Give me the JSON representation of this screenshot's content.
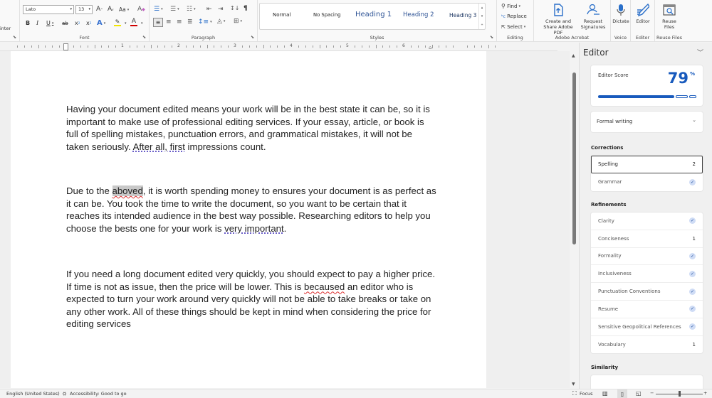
{
  "ribbon": {
    "clipboard": {
      "painter_label": "inter"
    },
    "font": {
      "group_label": "Font",
      "font_name": "Lato",
      "font_size": "13",
      "grow": "A",
      "shrink": "A",
      "change_case": "Aa",
      "bold": "B",
      "italic": "I",
      "underline": "U",
      "strikethrough": "ab",
      "subscript": "x",
      "superscript": "x",
      "text_effects": "A",
      "highlight": "✎",
      "font_color": "A",
      "highlight_color": "#f3e600",
      "font_color_bar": "#d00000"
    },
    "paragraph": {
      "group_label": "Paragraph",
      "show_marks": "¶"
    },
    "styles": {
      "group_label": "Styles",
      "items": [
        "Normal",
        "No Spacing",
        "Heading 1",
        "Heading 2",
        "Heading 3"
      ]
    },
    "editing": {
      "group_label": "Editing",
      "find": "Find",
      "replace": "Replace",
      "select": "Select"
    },
    "acrobat": {
      "group_label": "Adobe Acrobat",
      "create_share": "Create and Share Adobe PDF",
      "request_signatures": "Request Signatures"
    },
    "voice": {
      "group_label": "Voice",
      "dictate": "Dictate"
    },
    "editor": {
      "group_label": "Editor",
      "editor": "Editor"
    },
    "reuse": {
      "group_label": "Reuse Files",
      "reuse_files": "Reuse Files"
    }
  },
  "ruler": {
    "numbers": [
      "1",
      "2",
      "3",
      "4",
      "5",
      "6"
    ]
  },
  "document": {
    "paragraphs": [
      {
        "parts": [
          {
            "t": "Having your document edited means your work will be in the best state it can be, so it is important to make use of professional editing services. If your essay, article, or book is full of spelling mistakes, punctuation errors, and grammatical mistakes, it will not be taken seriously. "
          },
          {
            "t": "After all, first",
            "style": "grammar"
          },
          {
            "t": " impressions count."
          }
        ]
      },
      {
        "parts": [
          {
            "t": "Due to the "
          },
          {
            "t": "aboved",
            "style": "spelling-hl"
          },
          {
            "t": ", it is worth spending money to ensures your document is as perfect as it can be. You took the time to write the document, so you want to be certain that it reaches its intended audience in the best way possible. Researching editors to help you choose the bests one for your work is "
          },
          {
            "t": "very important",
            "style": "grammar"
          },
          {
            "t": "."
          }
        ]
      },
      {
        "parts": [
          {
            "t": "If you need a long document edited very quickly, you should expect to pay a higher price. If time is not as issue, then the price will be lower. This is "
          },
          {
            "t": "becaused",
            "style": "spelling"
          },
          {
            "t": " an editor who is expected to turn your work around very quickly will not be able to take breaks or take on any other work. All of these things should be kept in mind when considering the price for editing services"
          }
        ]
      }
    ]
  },
  "editor_pane": {
    "title": "Editor",
    "score_label": "Editor Score",
    "score_value": "79",
    "score_unit": "%",
    "score_fraction": 0.79,
    "accent_color": "#185abd",
    "mode": "Formal writing",
    "corrections": {
      "title": "Corrections",
      "items": [
        {
          "label": "Spelling",
          "count": "2",
          "selected": true
        },
        {
          "label": "Grammar",
          "check": true
        }
      ]
    },
    "refinements": {
      "title": "Refinements",
      "items": [
        {
          "label": "Clarity",
          "check": true
        },
        {
          "label": "Conciseness",
          "count": "1"
        },
        {
          "label": "Formality",
          "check": true
        },
        {
          "label": "Inclusiveness",
          "check": true
        },
        {
          "label": "Punctuation Conventions",
          "check": true
        },
        {
          "label": "Resume",
          "check": true
        },
        {
          "label": "Sensitive Geopolitical References",
          "check": true
        },
        {
          "label": "Vocabulary",
          "count": "1"
        }
      ]
    },
    "similarity": {
      "title": "Similarity"
    }
  },
  "status_bar": {
    "language": "English (United States)",
    "accessibility": "Accessibility: Good to go",
    "focus": "Focus"
  }
}
